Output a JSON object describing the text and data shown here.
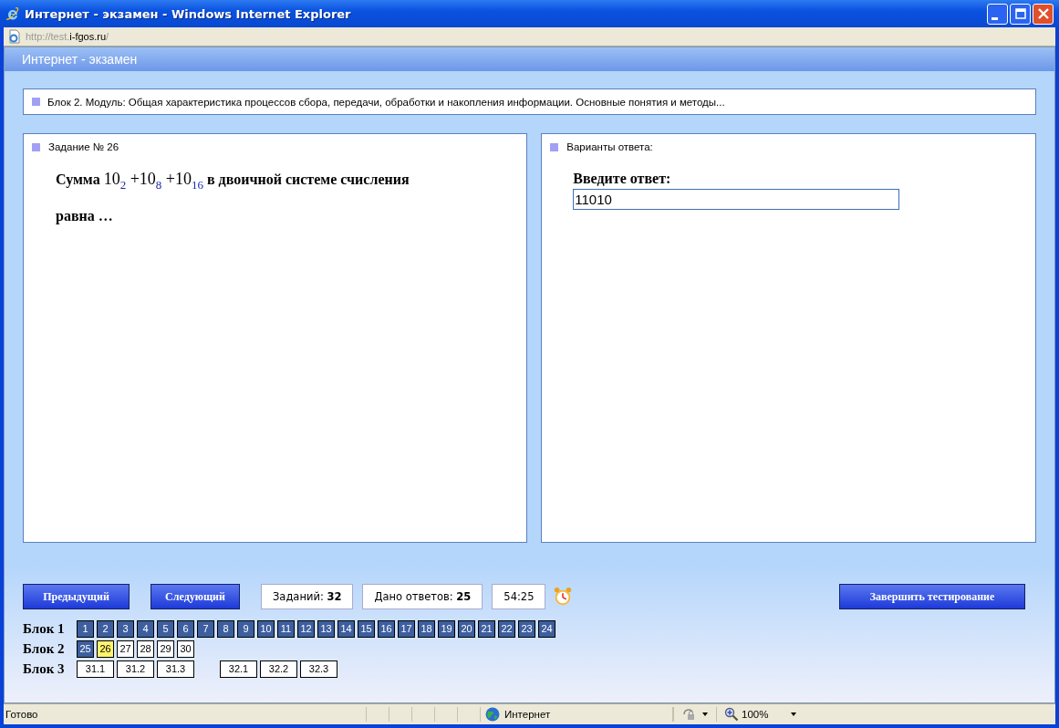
{
  "window": {
    "title": "Интернет - экзамен - Windows Internet Explorer"
  },
  "address": {
    "prefix": "http://test.",
    "domain": "i-fgos.ru",
    "suffix": "/"
  },
  "header": {
    "title": "Интернет - экзамен"
  },
  "breadcrumb": "Блок 2. Модуль: Общая характеристика процессов сбора, передачи, обработки и накопления информации. Основные понятия и методы...",
  "task": {
    "heading": "Задание № 26",
    "text_start": "Сумма",
    "formula": "10$_{2}$ +10$_{8}$ +10$_{16}$",
    "text_end": "в двоичной системе счисления равна …"
  },
  "answer": {
    "heading": "Варианты ответа:",
    "prompt": "Введите ответ:",
    "value": "11010"
  },
  "controls": {
    "prev": "Предыдущий",
    "next": "Следующий",
    "tasks_label": "Заданий:",
    "tasks_value": "32",
    "answered_label": "Дано ответов:",
    "answered_value": "25",
    "timer": "54:25",
    "finish": "Завершить тестирование"
  },
  "blocks": [
    {
      "label": "Блок 1",
      "items": [
        {
          "label": "1",
          "answered": true,
          "selected": false
        },
        {
          "label": "2",
          "answered": true,
          "selected": false
        },
        {
          "label": "3",
          "answered": true,
          "selected": false
        },
        {
          "label": "4",
          "answered": true,
          "selected": false
        },
        {
          "label": "5",
          "answered": true,
          "selected": false
        },
        {
          "label": "6",
          "answered": true,
          "selected": false
        },
        {
          "label": "7",
          "answered": true,
          "selected": false
        },
        {
          "label": "8",
          "answered": true,
          "selected": false
        },
        {
          "label": "9",
          "answered": true,
          "selected": false
        },
        {
          "label": "10",
          "answered": true,
          "selected": false
        },
        {
          "label": "11",
          "answered": true,
          "selected": false
        },
        {
          "label": "12",
          "answered": true,
          "selected": false
        },
        {
          "label": "13",
          "answered": true,
          "selected": false
        },
        {
          "label": "14",
          "answered": true,
          "selected": false
        },
        {
          "label": "15",
          "answered": true,
          "selected": false
        },
        {
          "label": "16",
          "answered": true,
          "selected": false
        },
        {
          "label": "17",
          "answered": true,
          "selected": false
        },
        {
          "label": "18",
          "answered": true,
          "selected": false
        },
        {
          "label": "19",
          "answered": true,
          "selected": false
        },
        {
          "label": "20",
          "answered": true,
          "selected": false
        },
        {
          "label": "21",
          "answered": true,
          "selected": false
        },
        {
          "label": "22",
          "answered": true,
          "selected": false
        },
        {
          "label": "23",
          "answered": true,
          "selected": false
        },
        {
          "label": "24",
          "answered": true,
          "selected": false
        }
      ]
    },
    {
      "label": "Блок 2",
      "items": [
        {
          "label": "25",
          "answered": true,
          "selected": false
        },
        {
          "label": "26",
          "answered": false,
          "selected": true
        },
        {
          "label": "27",
          "answered": false,
          "selected": false
        },
        {
          "label": "28",
          "answered": false,
          "selected": false
        },
        {
          "label": "29",
          "answered": false,
          "selected": false
        },
        {
          "label": "30",
          "answered": false,
          "selected": false
        }
      ]
    },
    {
      "label": "Блок 3",
      "items": [
        {
          "label": "31.1",
          "answered": false,
          "selected": false
        },
        {
          "label": "31.2",
          "answered": false,
          "selected": false
        },
        {
          "label": "31.3",
          "answered": false,
          "selected": false
        }
      ],
      "items_2": [
        {
          "label": "32.1",
          "answered": false,
          "selected": false
        },
        {
          "label": "32.2",
          "answered": false,
          "selected": false
        },
        {
          "label": "32.3",
          "answered": false,
          "selected": false
        }
      ]
    }
  ],
  "status_bar": {
    "text": "Готово",
    "zone": "Интернет",
    "zoom": "100%"
  }
}
